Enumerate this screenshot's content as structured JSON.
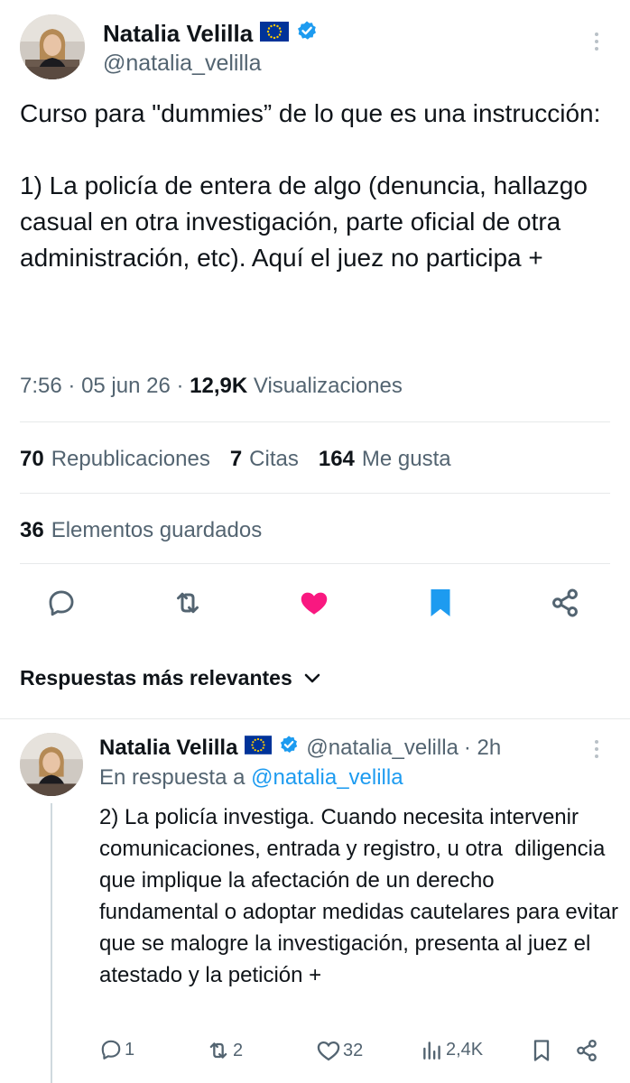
{
  "tweet": {
    "author_name": "Natalia Velilla",
    "author_handle": "@natalia_velilla",
    "text": "Curso para \"dummies” de lo que es una instrucción:\n\n1) La policía de entera de algo (denuncia, hallazgo casual en otra investigación, parte oficial de otra administración, etc). Aquí el juez no participa +",
    "time": "7:56",
    "date": "05 jun 26",
    "separator": "·",
    "views_count": "12,9K",
    "views_label": "Visualizaciones"
  },
  "stats": {
    "reposts_count": "70",
    "reposts_label": "Republicaciones",
    "quotes_count": "7",
    "quotes_label": "Citas",
    "likes_count": "164",
    "likes_label": "Me gusta",
    "bookmarks_count": "36",
    "bookmarks_label": "Elementos guardados"
  },
  "actions": {
    "reply_icon": "reply-icon",
    "repost_icon": "repost-icon",
    "like_icon": "heart-filled-icon",
    "bookmark_icon": "bookmark-filled-icon",
    "share_icon": "share-icon"
  },
  "replies_sort": {
    "label": "Respuestas más relevantes"
  },
  "reply": {
    "author_name": "Natalia Velilla",
    "author_handle": "@natalia_velilla",
    "time_ago": "· 2h",
    "in_reply_prefix": "En respuesta a",
    "in_reply_mention": "@natalia_velilla",
    "text": "2) La policía investiga. Cuando necesita intervenir comunicaciones, entrada y registro, u otra  diligencia que implique la afectación de un derecho fundamental o adoptar medidas cautelares para evitar que se malogre la investigación, presenta al juez el atestado y la petición +",
    "replies_count": "1",
    "reposts_count": "2",
    "likes_count": "32",
    "views_count": "2,4K"
  },
  "colors": {
    "like_pink": "#f91880",
    "bookmark_blue": "#1d9bf0",
    "verified_blue": "#1d9bf0",
    "secondary_text": "#536471",
    "eu_flag_blue": "#003399",
    "eu_flag_stars": "#ffcc00"
  }
}
